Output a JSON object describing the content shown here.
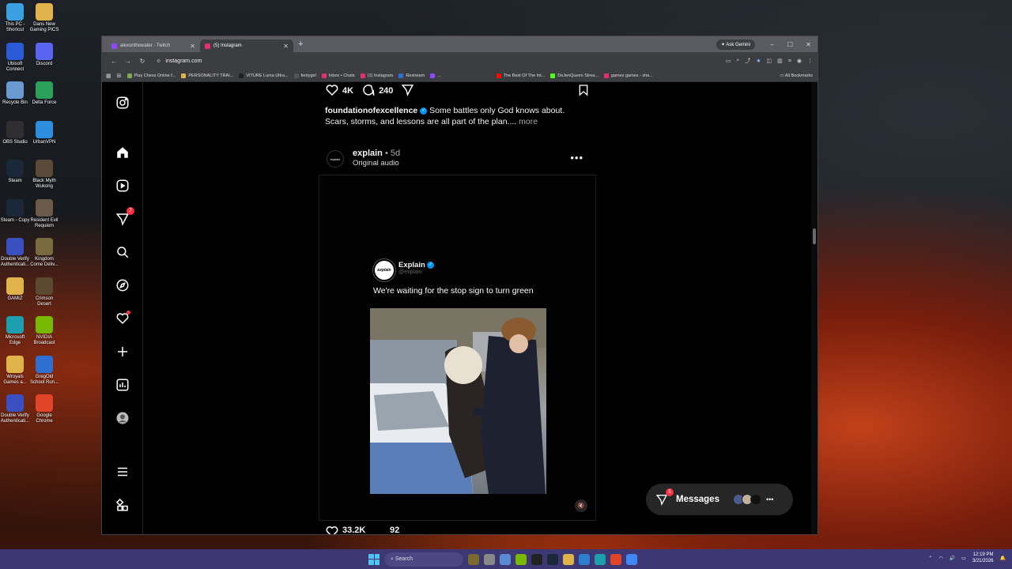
{
  "desktop": {
    "icons": [
      {
        "label": "This PC - Shortcut",
        "color": "#3aa0e0"
      },
      {
        "label": "Dans New Gaming PICS",
        "color": "#e0b34a"
      },
      {
        "label": "Ubisoft Connect",
        "color": "#2a5ad6"
      },
      {
        "label": "Discord",
        "color": "#5865f2"
      },
      {
        "label": "Recycle Bin",
        "color": "#6a9ad0"
      },
      {
        "label": "Delta Force",
        "color": "#2aa05a"
      },
      {
        "label": "OBS Studio",
        "color": "#302e31"
      },
      {
        "label": "UrbanVPN",
        "color": "#2d8ee0"
      },
      {
        "label": "Steam",
        "color": "#1b2838"
      },
      {
        "label": "Black Myth Wukong",
        "color": "#5a4a3a"
      },
      {
        "label": "Steam - Copy",
        "color": "#1b2838"
      },
      {
        "label": "Resident Evil Requiem",
        "color": "#6a5a4a"
      },
      {
        "label": "Double Verify Authenticati...",
        "color": "#3a50c0"
      },
      {
        "label": "Kingdom Come Deliv...",
        "color": "#7a6a40"
      },
      {
        "label": "GAMIZ",
        "color": "#e0b34a"
      },
      {
        "label": "Crimson Desert",
        "color": "#5a4a30"
      },
      {
        "label": "Microsoft Edge",
        "color": "#1d9fb0"
      },
      {
        "label": "NVIDIA Broadcast",
        "color": "#76b900"
      },
      {
        "label": "Wroyals Games a...",
        "color": "#e0b34a"
      },
      {
        "label": "GregOld School Run...",
        "color": "#2d6ed0"
      },
      {
        "label": "Double Verify Authenticati...",
        "color": "#3a50c0"
      },
      {
        "label": "Google Chrome",
        "color": "#e0452a"
      }
    ]
  },
  "browser": {
    "tabs": [
      {
        "title": "alexonthewater - Twitch",
        "color": "#9146ff",
        "active": false
      },
      {
        "title": "(5) Instagram",
        "color": "#e1306c",
        "active": true
      }
    ],
    "new_tab": "+",
    "ask_gemini": "Ask Gemini",
    "window_controls": {
      "minimize": "–",
      "maximize": "☐",
      "close": "✕"
    },
    "url": "instagram.com",
    "bookmarks": [
      {
        "label": "Play Chess Online f...",
        "color": "#7fa650"
      },
      {
        "label": "PERSONALITY TRAI...",
        "color": "#e0b34a"
      },
      {
        "label": "VITURE Luma Ultra...",
        "color": "#222"
      },
      {
        "label": "fentygirl",
        "color": "#555"
      },
      {
        "label": "Inbox • Chats",
        "color": "#e1306c"
      },
      {
        "label": "(1) Instagram",
        "color": "#e1306c"
      },
      {
        "label": "Restream",
        "color": "#2d6ed0"
      },
      {
        "label": "...",
        "color": "#9146ff"
      },
      {
        "label": "The Best Of The Int...",
        "color": "#ff0000"
      },
      {
        "label": "DeJenQueen Strea...",
        "color": "#53fc18"
      },
      {
        "label": "games games - sha...",
        "color": "#e1306c"
      }
    ],
    "all_bookmarks": "All Bookmarks"
  },
  "instagram": {
    "sidebar": {
      "notifications_badge": "7"
    },
    "prev_post": {
      "likes": "4K",
      "comments": "240",
      "username": "foundationofexcellence",
      "caption": "Some battles only God knows about. Scars, storms, and lessons are all part of the plan....",
      "more": "more"
    },
    "post": {
      "avatar_text": "explain",
      "username": "explain",
      "age": "• 5d",
      "audio": "Original audio",
      "menu": "•••",
      "tweet": {
        "avatar_text": "explain",
        "name": "Explain",
        "handle": "@explain",
        "text": "We're waiting for the stop sign to turn green"
      },
      "next_likes": "33.2K",
      "next_comments": "92"
    },
    "messages": {
      "label": "Messages",
      "badge": "5",
      "avatars": [
        "#4a5a8a",
        "#c0b0a0",
        "#111"
      ],
      "more": "•••"
    }
  },
  "taskbar": {
    "search_placeholder": "Search",
    "pinned": [
      "#7a6a30",
      "#888",
      "#5a8ad0",
      "#76b900",
      "#222",
      "#1b2838",
      "#e0b34a",
      "#2d7dd2",
      "#1d9fb0",
      "#e0452a",
      "#4285f4"
    ],
    "time": "12:19 PM",
    "date": "3/21/2026"
  }
}
